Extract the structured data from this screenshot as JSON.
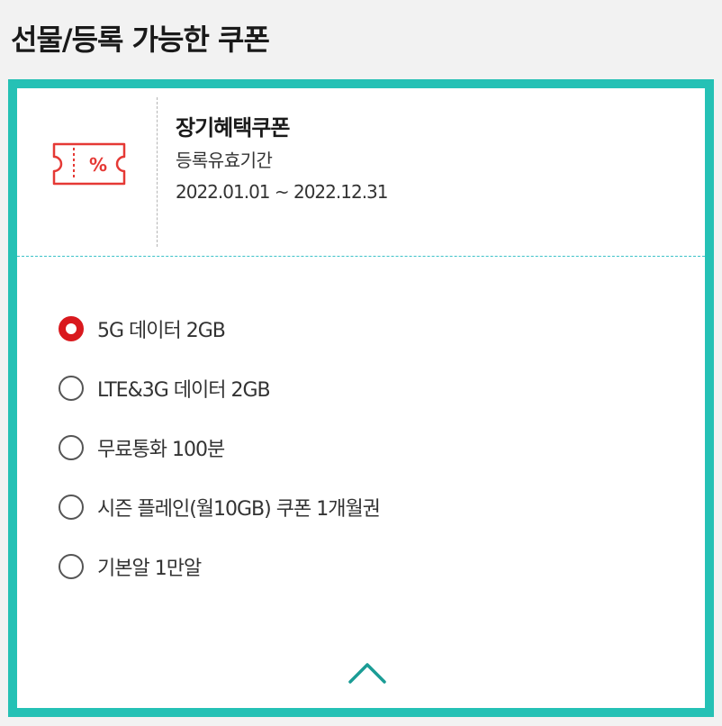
{
  "header": {
    "title": "선물/등록 가능한 쿠폰"
  },
  "coupon": {
    "icon": "percent-ticket-icon",
    "icon_text": "%",
    "name": "장기혜택쿠폰",
    "period_label": "등록유효기간",
    "period_value": "2022.01.01 ~ 2022.12.31",
    "options": [
      {
        "label": "5G 데이터 2GB",
        "selected": true
      },
      {
        "label": "LTE&3G 데이터 2GB",
        "selected": false
      },
      {
        "label": "무료통화 100분",
        "selected": false
      },
      {
        "label": "시즌 플레인(월10GB) 쿠폰 1개월권",
        "selected": false
      },
      {
        "label": "기본알 1만알",
        "selected": false
      }
    ],
    "collapse_icon": "chevron-up-icon"
  },
  "colors": {
    "accent_border": "#25c1b5",
    "selected_radio": "#d9191e",
    "icon_red": "#e53935",
    "chevron": "#1a9c95"
  }
}
